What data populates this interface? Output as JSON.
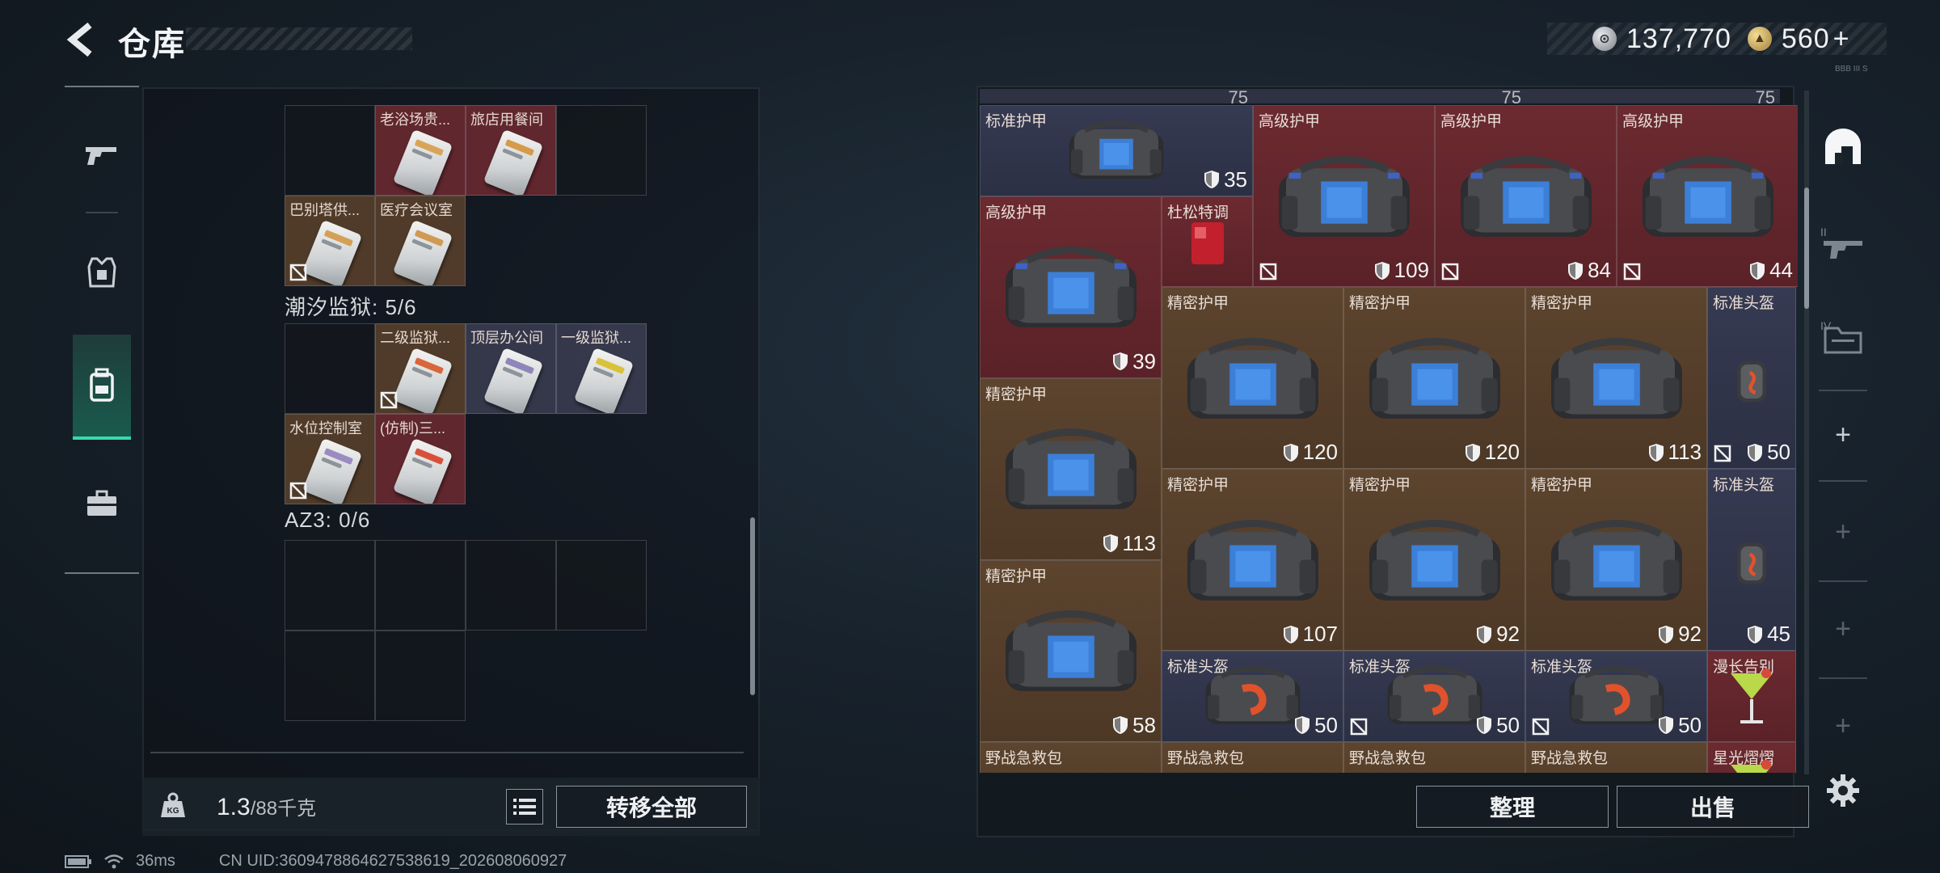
{
  "header": {
    "title": "仓库"
  },
  "currency": {
    "silver": "137,770",
    "gold": "560",
    "gold_plus": "+"
  },
  "left_rail": {
    "items": [
      "gun-icon",
      "armor-icon",
      "backpack-icon",
      "case-icon"
    ],
    "active_index": 2
  },
  "left_panel": {
    "groups": [
      {
        "label": "",
        "cells": [
          {
            "name": "",
            "color": "empty",
            "locked": false
          },
          {
            "name": "老浴场贵...",
            "color": "red",
            "card_color": "#d9a45a",
            "locked": false
          },
          {
            "name": "旅店用餐间",
            "color": "red",
            "card_color": "#d59a4a",
            "locked": false
          },
          {
            "name": "",
            "color": "empty",
            "locked": false
          },
          {
            "name": "巴别塔供...",
            "color": "brown",
            "card_color": "#d3a056",
            "locked": true
          },
          {
            "name": "医疗会议室",
            "color": "brown",
            "card_color": "#cf9a52",
            "locked": false
          }
        ]
      },
      {
        "label": "潮汐监狱: 5/6",
        "cells": [
          {
            "name": "",
            "color": "empty",
            "locked": false
          },
          {
            "name": "二级监狱...",
            "color": "brown",
            "card_color": "#d9663a",
            "locked": true
          },
          {
            "name": "顶层办公间",
            "color": "slate",
            "card_color": "#8e86b8",
            "locked": false
          },
          {
            "name": "一级监狱...",
            "color": "slate",
            "card_color": "#d9c23a",
            "locked": false
          },
          {
            "name": "水位控制室",
            "color": "brown",
            "card_color": "#9a8cc0",
            "locked": true
          },
          {
            "name": "(仿制)三...",
            "color": "red",
            "card_color": "#d9503a",
            "locked": false
          }
        ]
      },
      {
        "label": "AZ3: 0/6"
      }
    ]
  },
  "weight": {
    "current": "1.3",
    "max": "/88千克",
    "icon_label": "KG"
  },
  "buttons": {
    "transfer_all": "转移全部",
    "sort": "整理",
    "sell": "出售"
  },
  "status": {
    "ping": "36ms",
    "uid": "CN UID:3609478864627538619_202608060927"
  },
  "top_row_values": [
    "75",
    "75",
    "75"
  ],
  "stash_items": [
    {
      "name": "标准护甲",
      "durability": "35",
      "color": "slate",
      "kind": "armor-std",
      "locked": false
    },
    {
      "name": "高级护甲",
      "durability": "109",
      "color": "red",
      "kind": "armor-adv",
      "locked": true
    },
    {
      "name": "高级护甲",
      "durability": "84",
      "color": "red",
      "kind": "armor-adv",
      "locked": true
    },
    {
      "name": "高级护甲",
      "durability": "44",
      "color": "red",
      "kind": "armor-adv",
      "locked": true
    },
    {
      "name": "高级护甲",
      "durability": "39",
      "color": "red",
      "kind": "armor-adv",
      "locked": false
    },
    {
      "name": "杜松特调",
      "durability": "",
      "color": "red",
      "kind": "drink",
      "locked": false
    },
    {
      "name": "精密护甲",
      "durability": "120",
      "color": "brown",
      "kind": "armor-pre",
      "locked": false
    },
    {
      "name": "精密护甲",
      "durability": "120",
      "color": "brown",
      "kind": "armor-pre",
      "locked": false
    },
    {
      "name": "精密护甲",
      "durability": "113",
      "color": "brown",
      "kind": "armor-pre",
      "locked": false
    },
    {
      "name": "标准头盔",
      "durability": "50",
      "color": "slate",
      "kind": "helmet",
      "locked": true
    },
    {
      "name": "精密护甲",
      "durability": "113",
      "color": "brown",
      "kind": "armor-pre",
      "locked": false
    },
    {
      "name": "精密护甲",
      "durability": "107",
      "color": "brown",
      "kind": "armor-pre",
      "locked": false
    },
    {
      "name": "精密护甲",
      "durability": "92",
      "color": "brown",
      "kind": "armor-pre",
      "locked": false
    },
    {
      "name": "精密护甲",
      "durability": "92",
      "color": "brown",
      "kind": "armor-pre",
      "locked": false
    },
    {
      "name": "标准头盔",
      "durability": "45",
      "color": "slate",
      "kind": "helmet",
      "locked": false
    },
    {
      "name": "精密护甲",
      "durability": "58",
      "color": "brown",
      "kind": "armor-pre",
      "locked": false
    },
    {
      "name": "标准头盔",
      "durability": "50",
      "color": "slate",
      "kind": "helmet-wide",
      "locked": false
    },
    {
      "name": "标准头盔",
      "durability": "50",
      "color": "slate",
      "kind": "helmet-wide",
      "locked": true
    },
    {
      "name": "标准头盔",
      "durability": "50",
      "color": "slate",
      "kind": "helmet-wide",
      "locked": true
    },
    {
      "name": "漫长告别",
      "durability": "",
      "color": "red",
      "kind": "cocktail",
      "locked": false
    },
    {
      "name": "野战急救包",
      "durability": "",
      "color": "brown",
      "kind": "medkit",
      "locked": false
    },
    {
      "name": "野战急救包",
      "durability": "",
      "color": "brown",
      "kind": "medkit",
      "locked": false
    },
    {
      "name": "野战急救包",
      "durability": "",
      "color": "brown",
      "kind": "medkit",
      "locked": false
    },
    {
      "name": "野战急救包",
      "durability": "",
      "color": "brown",
      "kind": "medkit",
      "locked": false
    },
    {
      "name": "星光熠熠",
      "durability": "",
      "color": "red",
      "kind": "cocktail",
      "locked": false
    }
  ],
  "right_rail": {
    "items": [
      "storage-icon",
      "weapons-shelf-icon",
      "folder-icon"
    ],
    "plus_count": 4
  },
  "version_tag": "BBB III S"
}
